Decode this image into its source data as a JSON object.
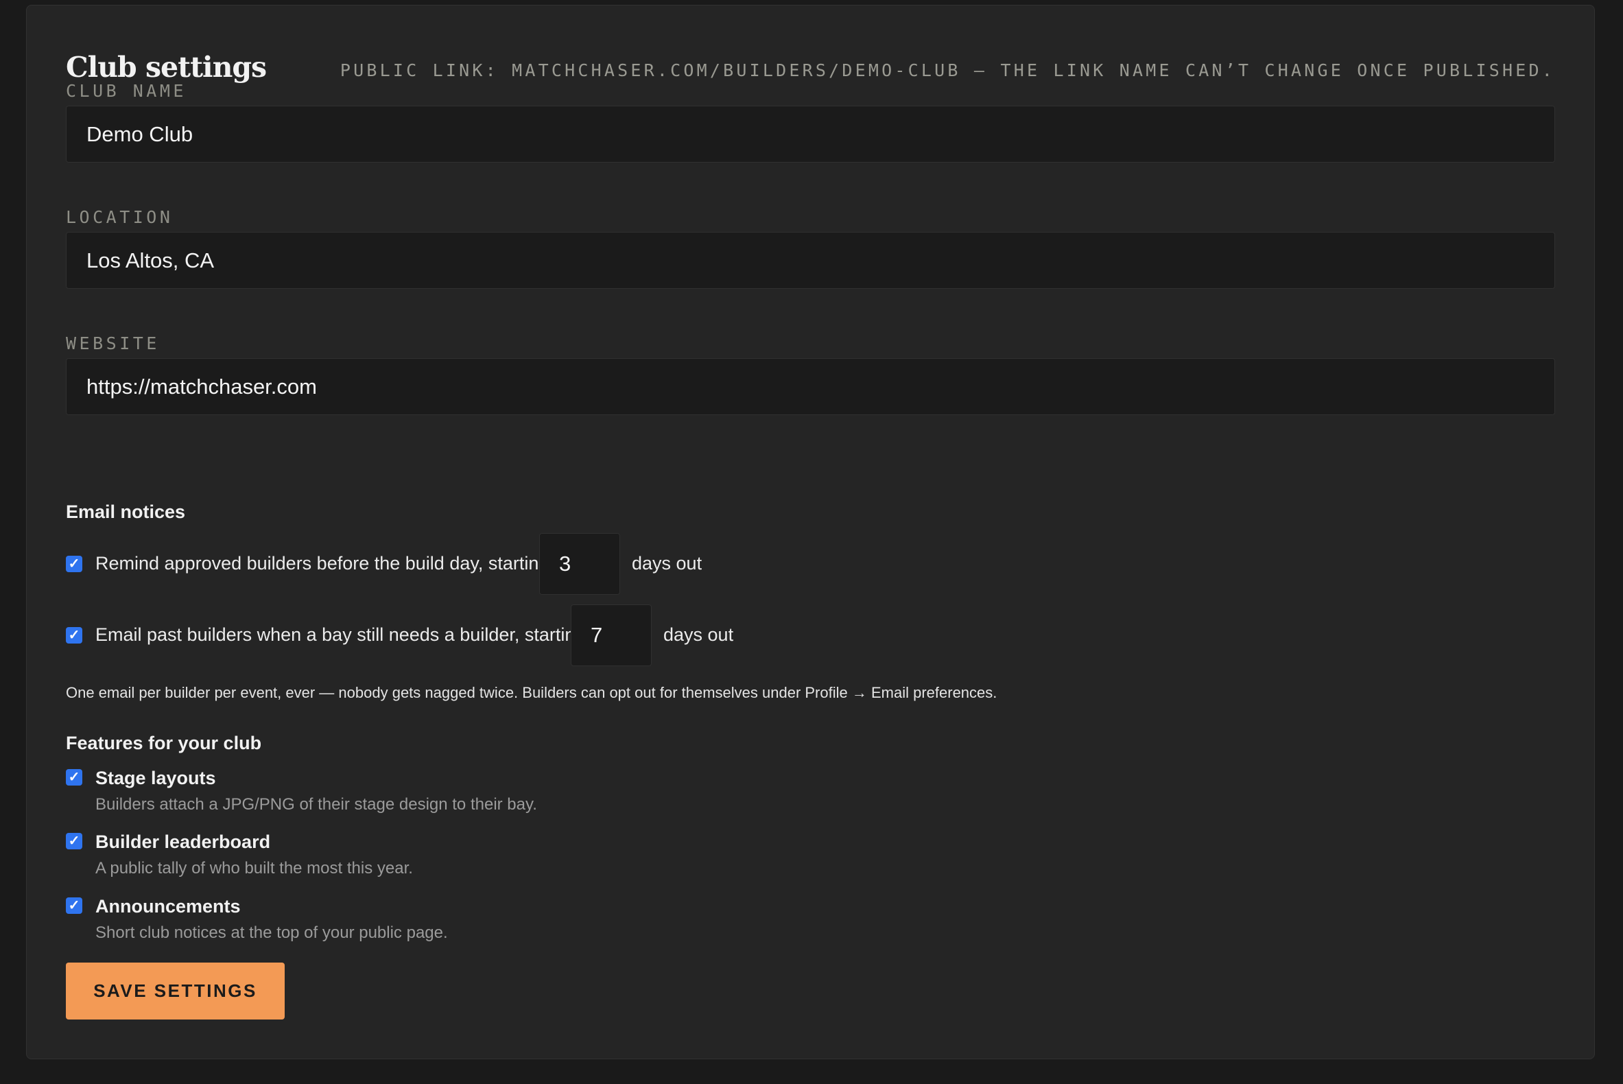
{
  "header": {
    "title": "Club settings",
    "public_note": "Public link: matchchaser.com/builders/demo-club — the link name can’t change once published."
  },
  "fields": {
    "club_name": {
      "label": "Club name",
      "value": "Demo Club"
    },
    "location": {
      "label": "Location",
      "value": "Los Altos, CA"
    },
    "website": {
      "label": "Website",
      "value": "https://matchchaser.com"
    }
  },
  "email_notices": {
    "heading": "Email notices",
    "reminder": {
      "checked": true,
      "text": "Remind approved builders before the build day, starting",
      "days": "3",
      "suffix": "days out"
    },
    "past_builders": {
      "checked": true,
      "text": "Email past builders when a bay still needs a builder, starting",
      "days": "7",
      "suffix": "days out"
    },
    "helper": "One email per builder per event, ever — nobody gets nagged twice. Builders can opt out for themselves under Profile → Email preferences."
  },
  "features": {
    "heading": "Features for your club",
    "items": [
      {
        "checked": true,
        "title": "Stage layouts",
        "description": "Builders attach a JPG/PNG of their stage design to their bay."
      },
      {
        "checked": true,
        "title": "Builder leaderboard",
        "description": "A public tally of who built the most this year."
      },
      {
        "checked": true,
        "title": "Announcements",
        "description": "Short club notices at the top of your public page."
      }
    ]
  },
  "save_label": "Save settings",
  "colors": {
    "background": "#1a1a1a",
    "card": "#252525",
    "input": "#1b1b1b",
    "accent": "#f39a55",
    "checkbox": "#2f74ef"
  },
  "icons": {
    "checkbox": "check-icon"
  }
}
